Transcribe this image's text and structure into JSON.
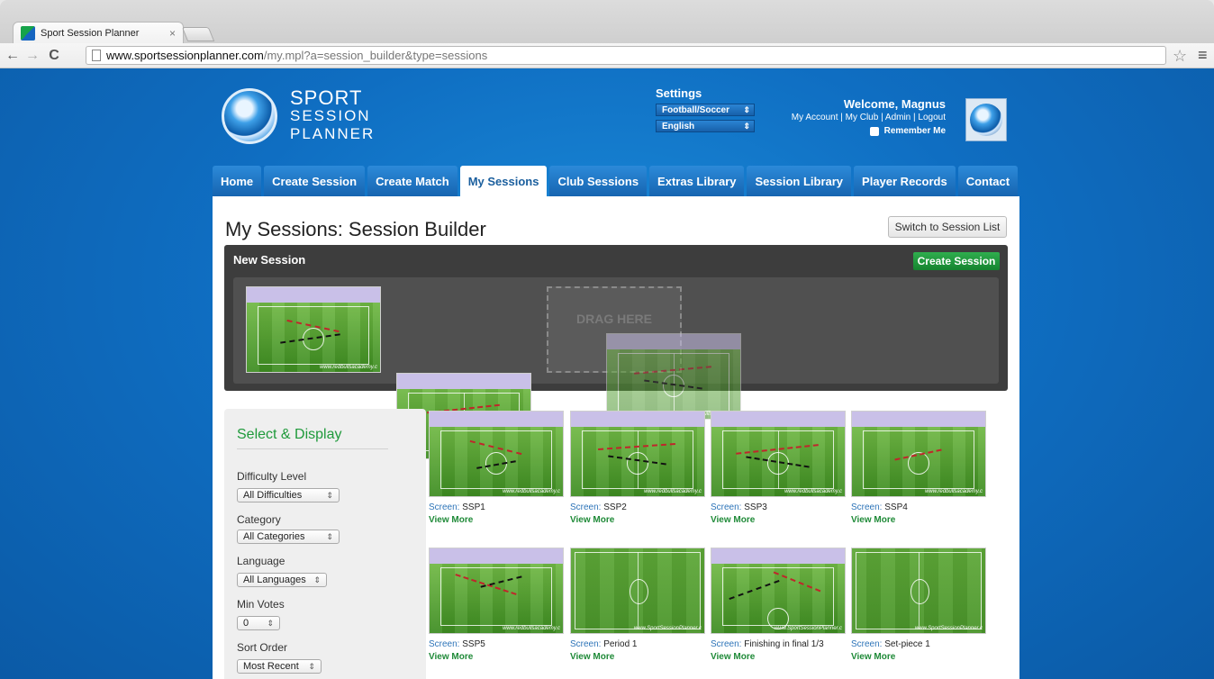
{
  "browser": {
    "tab_title": "Sport Session Planner",
    "tab_close": "×",
    "url_host": "www.sportsessionplanner.com",
    "url_path": "/my.mpl?a=session_builder&type=sessions",
    "back": "←",
    "forward": "→",
    "reload": "C",
    "star": "☆",
    "menu": "≡"
  },
  "logo": {
    "line1": "SPORT",
    "line2": "SESSION",
    "line3": "PLANNER"
  },
  "settings": {
    "title": "Settings",
    "sport": "Football/Soccer",
    "language": "English",
    "arrow": "⇕"
  },
  "account": {
    "welcome": "Welcome, Magnus",
    "links": "My Account | My Club | Admin | Logout",
    "remember": "Remember Me"
  },
  "nav": {
    "items": [
      "Home",
      "Create Session",
      "Create Match",
      "My Sessions",
      "Club Sessions",
      "Extras Library",
      "Session Library",
      "Player Records",
      "Contact"
    ],
    "active": "My Sessions"
  },
  "main": {
    "title": "My Sessions: Session Builder",
    "switch_label": "Switch to Session List"
  },
  "builder": {
    "title": "New Session",
    "create_label": "Create Session",
    "drop_label": "DRAG HERE",
    "watermark": "www.redbullsacademy.c"
  },
  "sidebar": {
    "title": "Select & Display",
    "filters": [
      {
        "label": "Difficulty Level",
        "value": "All Difficulties"
      },
      {
        "label": "Category",
        "value": "All Categories"
      },
      {
        "label": "Language",
        "value": "All Languages"
      },
      {
        "label": "Min Votes",
        "value": "0"
      },
      {
        "label": "Sort Order",
        "value": "Most Recent"
      }
    ],
    "arrow": "⇕"
  },
  "screens": {
    "prefix": "Screen:",
    "view_more": "View More",
    "items": [
      {
        "name": "SSP1",
        "watermark": "www.redbullsacademy.c"
      },
      {
        "name": "SSP2",
        "watermark": "www.redbullsacademy.c"
      },
      {
        "name": "SSP3",
        "watermark": "www.redbullsacademy.c"
      },
      {
        "name": "SSP4",
        "watermark": "www.redbullsacademy.c"
      },
      {
        "name": "SSP5",
        "watermark": "www.redbullsacademy.c"
      },
      {
        "name": "Period 1",
        "watermark": "www.SportSessionPlanner.c"
      },
      {
        "name": "Finishing in final 1/3",
        "watermark": "www.SportSessionPlanner.c"
      },
      {
        "name": "Set-piece 1",
        "watermark": "www.SportSessionPlanner.c"
      }
    ]
  }
}
